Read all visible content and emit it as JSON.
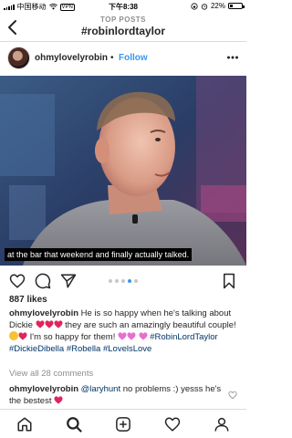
{
  "status_bar": {
    "carrier": "中国移动",
    "vpn": "VPN",
    "time": "下午8:38",
    "battery": "22%",
    "battery_level": 0.22
  },
  "header": {
    "eyebrow": "TOP POSTS",
    "title": "#robinlordtaylor"
  },
  "post": {
    "username": "ohmylovelyrobin",
    "dot": "•",
    "follow_label": "Follow",
    "subtitle": "at the bar that weekend and finally actually talked.",
    "page_count": 5,
    "active_page": 4,
    "likes": "887 likes"
  },
  "caption": {
    "username": "ohmylovelyrobin",
    "text_1": "He is so happy when he's talking about Dickie",
    "text_2": "they are such an amazingly beautiful couple!",
    "text_3": "I'm so happy for them!",
    "hashtags": "#RobinLordTaylor #DickieDibella #Robella #LovelsLove"
  },
  "comments": {
    "view_all": "View all 28 comments",
    "items": [
      {
        "username": "ohmylovelyrobin",
        "mention": "@laryhunt",
        "text": "no problems :) yesss he's the bestest"
      }
    ]
  },
  "colors": {
    "link_blue": "#3897f0",
    "hashtag": "#003569",
    "heart_red": "#e0245e",
    "heart_pink": "#e86fd0",
    "muted": "#8e8e8e"
  },
  "icons": {
    "back": "chevron-left-icon",
    "more": "more-horizontal-icon",
    "like": "heart-icon",
    "comment": "comment-icon",
    "share": "paper-plane-icon",
    "save": "bookmark-icon",
    "home": "home-icon",
    "search": "search-icon",
    "new_post": "plus-square-icon",
    "activity": "heart-icon",
    "profile": "profile-icon"
  }
}
